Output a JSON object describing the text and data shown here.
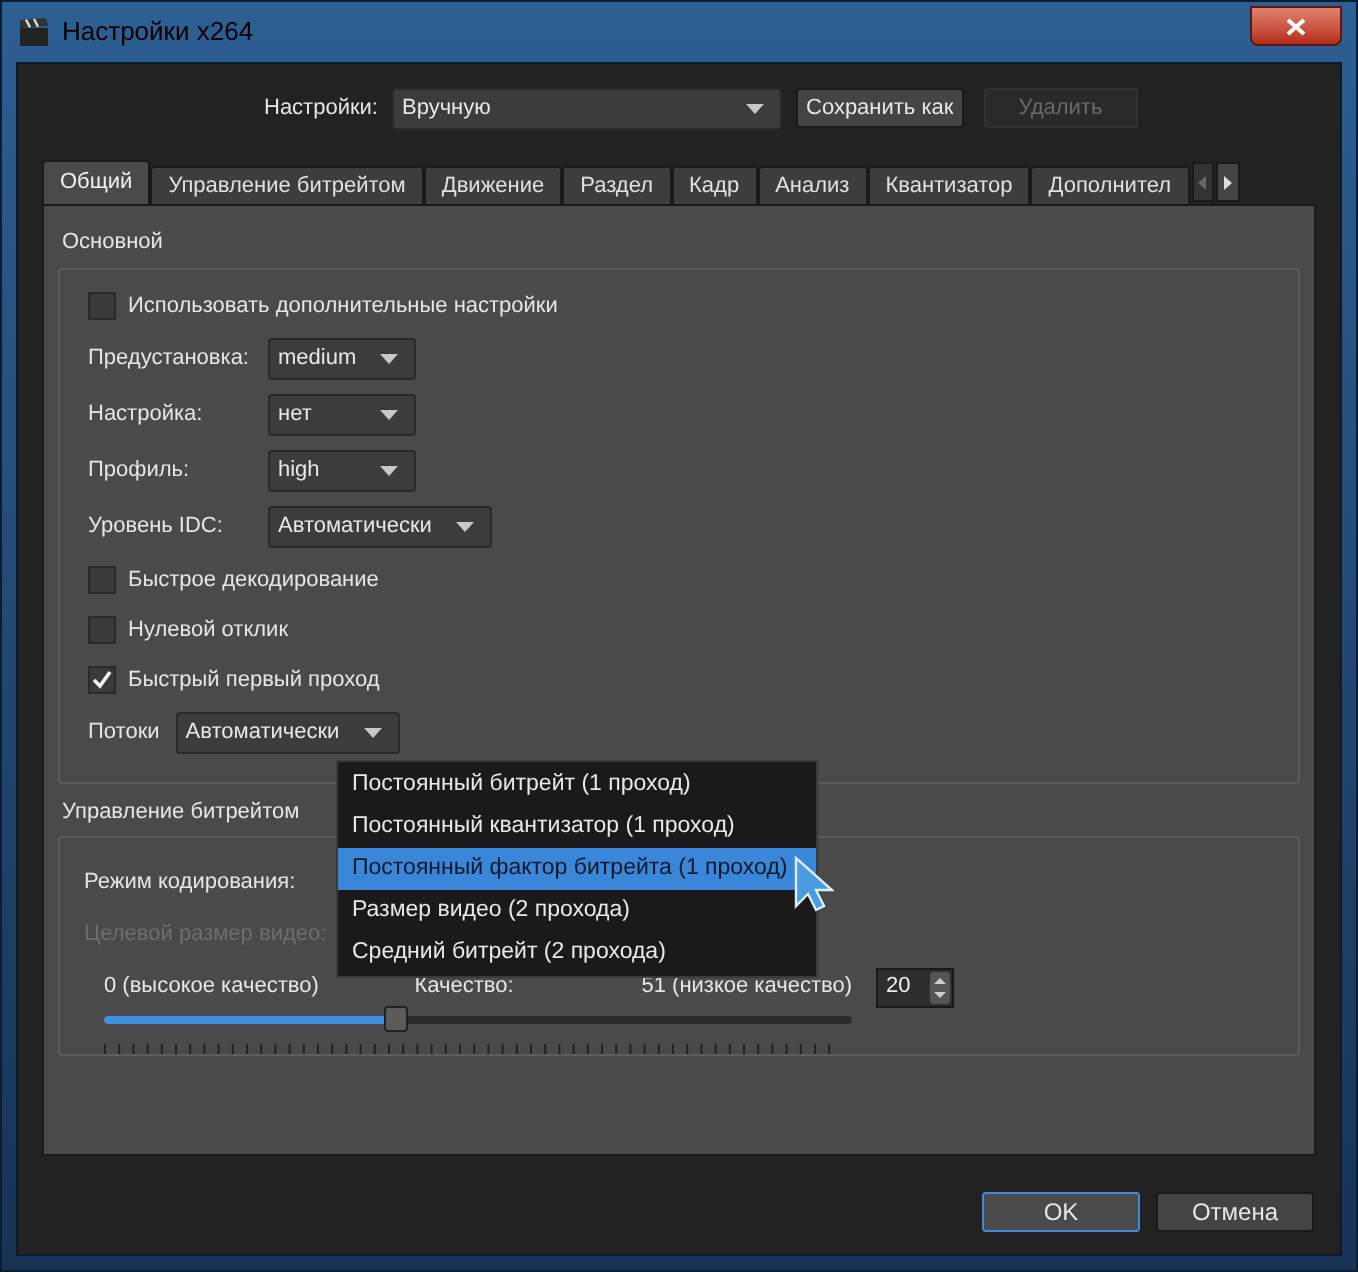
{
  "window": {
    "title": "Настройки x264"
  },
  "preset_bar": {
    "label": "Настройки:",
    "value": "Вручную",
    "buttons": [
      {
        "label": "Сохранить как",
        "disabled": false
      },
      {
        "label": "Удалить",
        "disabled": true
      }
    ]
  },
  "tabs": [
    {
      "label": "Общий",
      "selected": true
    },
    {
      "label": "Управление битрейтом",
      "selected": false
    },
    {
      "label": "Движение",
      "selected": false
    },
    {
      "label": "Раздел",
      "selected": false
    },
    {
      "label": "Кадр",
      "selected": false
    },
    {
      "label": "Анализ",
      "selected": false
    },
    {
      "label": "Квантизатор",
      "selected": false
    },
    {
      "label": "Дополнител",
      "selected": false
    }
  ],
  "general": {
    "title": "Основной",
    "rows": [
      {
        "kind": "checkbox",
        "label": "Использовать дополнительные настройки",
        "checked": false
      },
      {
        "kind": "combo",
        "label": "Предустановка:",
        "value": "medium"
      },
      {
        "kind": "combo",
        "label": "Настройка:",
        "value": "нет"
      },
      {
        "kind": "combo",
        "label": "Профиль:",
        "value": "high"
      },
      {
        "kind": "combo",
        "label": "Уровень IDC:",
        "value": "Автоматически"
      },
      {
        "kind": "checkbox",
        "label": "Быстрое декодирование",
        "checked": false
      },
      {
        "kind": "checkbox",
        "label": "Нулевой отклик",
        "checked": false
      },
      {
        "kind": "checkbox",
        "label": "Быстрый первый проход",
        "checked": true
      },
      {
        "kind": "inline_combo",
        "label": "Потоки",
        "value": "Автоматически"
      }
    ]
  },
  "rate_control": {
    "title": "Управление битрейтом",
    "mode_label": "Режим кодирования:",
    "target_label": "Целевой размер видео:",
    "target_disabled": true,
    "slider": {
      "min_label": "0 (высокое качество)",
      "caption": "Качество:",
      "max_label": "51 (низкое качество)",
      "level": 0.39,
      "value": "20"
    }
  },
  "dropdown": {
    "options": [
      {
        "label": "Постоянный битрейт (1 проход)",
        "selected": false
      },
      {
        "label": "Постоянный квантизатор (1 проход)",
        "selected": false
      },
      {
        "label": "Постоянный фактор битрейта (1 проход)",
        "selected": true
      },
      {
        "label": "Размер видео (2 прохода)",
        "selected": false
      },
      {
        "label": "Средний битрейт (2 прохода)",
        "selected": false
      }
    ]
  },
  "buttons": [
    {
      "label": "OK",
      "default": true
    },
    {
      "label": "Отмена",
      "default": false
    }
  ]
}
